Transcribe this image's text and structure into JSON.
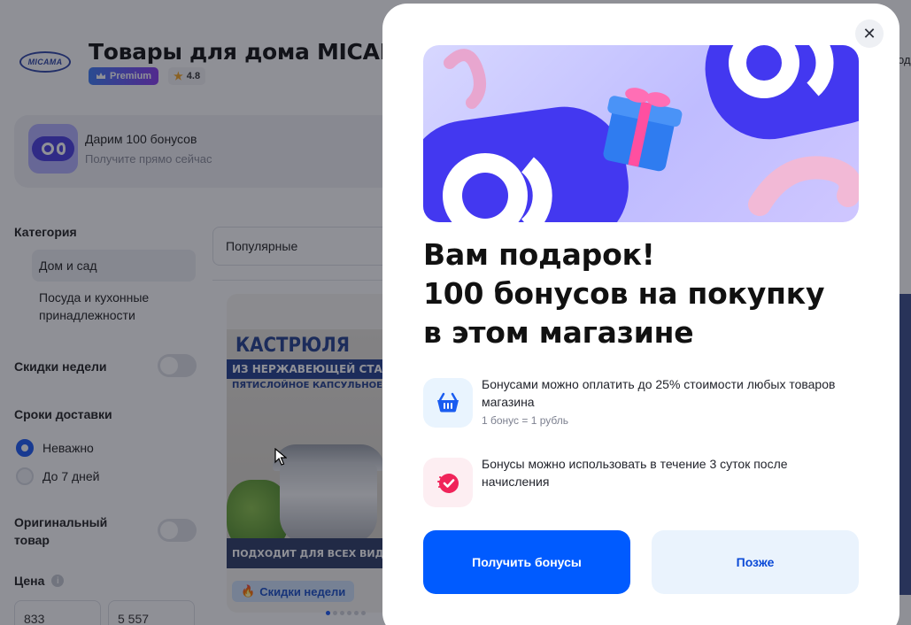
{
  "store": {
    "logo_text": "MICAMA",
    "title": "Товары для дома MICAMA",
    "premium_label": "Premium",
    "rating": "4.8"
  },
  "banner": {
    "title": "Дарим 100 бонусов",
    "subtitle": "Получите прямо сейчас"
  },
  "filters": {
    "category_title": "Категория",
    "categories": [
      "Дом и сад",
      "Посуда и кухонные принадлежности"
    ],
    "weekly_sales_label": "Скидки недели",
    "delivery_title": "Сроки доставки",
    "delivery_options": [
      "Неважно",
      "До 7 дней"
    ],
    "original_label": "Оригинальный товар",
    "price_title": "Цена",
    "price_from": "833",
    "price_to": "5 557"
  },
  "sort": {
    "selected": "Популярные"
  },
  "product": {
    "headline": "КАСТРЮЛЯ",
    "line2": "ИЗ НЕРЖАВЕЮЩЕЙ СТАЛ",
    "line3": "ПЯТИСЛОЙНОЕ КАПСУЛЬНОЕ ДНО",
    "footer": "ПОДХОДИТ ДЛЯ ВСЕХ ВИДОВ ПЛИТ",
    "sale_chip": "Скидки недели"
  },
  "right_edge_label": "од",
  "modal": {
    "title_lines": [
      "Вам подарок!",
      "100 бонусов на покупку",
      "в этом магазине"
    ],
    "info1_text": "Бонусами можно оплатить до 25% стоимости любых товаров магазина",
    "info1_sub": "1 бонус = 1 рубль",
    "info2_text": "Бонусы можно использовать в течение 3 суток после начисления",
    "primary_button": "Получить бонусы",
    "secondary_button": "Позже"
  },
  "colors": {
    "accent": "#005bff",
    "secondary_bg": "#eaf3fd",
    "info1_bg": "#e9f4fe",
    "info2_bg": "#fdeef2",
    "overlay": "rgba(20,22,35,0.48)"
  },
  "icons": {
    "close": "close-icon",
    "basket": "basket-icon",
    "timer": "timer-check-icon",
    "crown": "crown-icon",
    "star": "star-icon",
    "fire": "fire-icon",
    "info": "info-icon"
  }
}
